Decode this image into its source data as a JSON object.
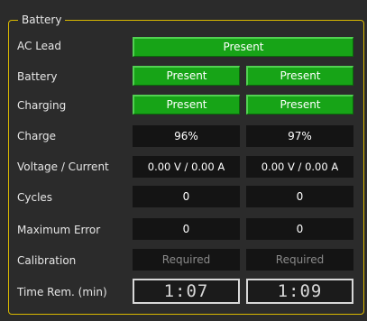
{
  "group_title": "Battery",
  "rows": {
    "ac_lead": {
      "label": "AC Lead",
      "value": "Present"
    },
    "battery": {
      "label": "Battery",
      "left": "Present",
      "right": "Present"
    },
    "charging": {
      "label": "Charging",
      "left": "Present",
      "right": "Present"
    },
    "charge": {
      "label": "Charge",
      "left": "96%",
      "right": "97%"
    },
    "voltage_current": {
      "label": "Voltage / Current",
      "left": "0.00 V / 0.00 A",
      "right": "0.00 V / 0.00 A"
    },
    "cycles": {
      "label": "Cycles",
      "left": "0",
      "right": "0"
    },
    "maximum_error": {
      "label": "Maximum Error",
      "left": "0",
      "right": "0"
    },
    "calibration": {
      "label": "Calibration",
      "left": "Required",
      "right": "Required"
    },
    "time_remaining": {
      "label": "Time Rem. (min)",
      "left": "1:07",
      "right": "1:09"
    }
  },
  "colors": {
    "accent_border": "#d9b800",
    "present_green": "#17a417",
    "value_box": "#141414"
  }
}
